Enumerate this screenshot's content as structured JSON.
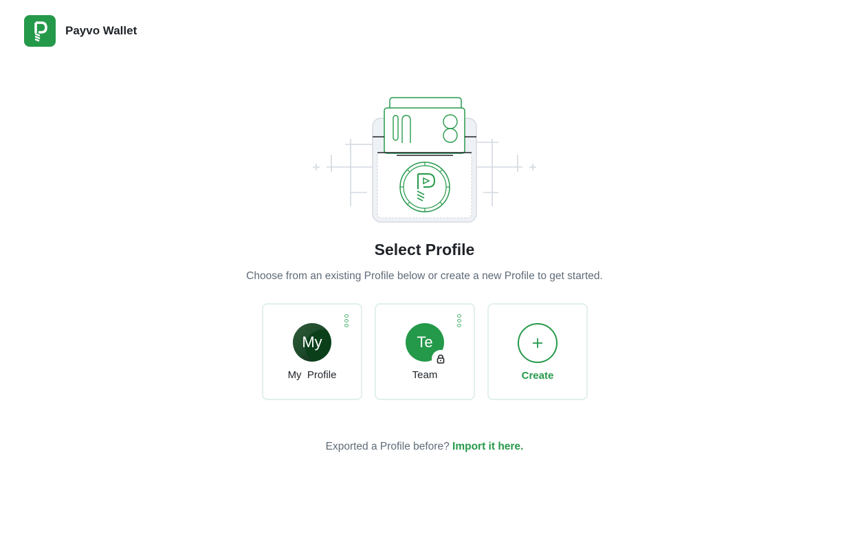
{
  "app": {
    "name": "Payvo Wallet",
    "logo_icon": "payvo-logo-icon",
    "accent_color": "#25994a"
  },
  "main": {
    "illustration_icon": "wallet-with-cards-illustration",
    "title": "Select Profile",
    "subtitle": "Choose from an existing Profile below or create a new Profile to get started."
  },
  "profiles": [
    {
      "initials": "My",
      "name": "My  Profile",
      "locked": false,
      "menu_icon": "more-options-icon"
    },
    {
      "initials": "Te",
      "name": "Team",
      "locked": true,
      "menu_icon": "more-options-icon",
      "badge_icon": "lock-icon"
    }
  ],
  "create": {
    "label": "Create",
    "icon": "plus-icon"
  },
  "import": {
    "text": "Exported a Profile before?",
    "link_label": "Import it here."
  }
}
